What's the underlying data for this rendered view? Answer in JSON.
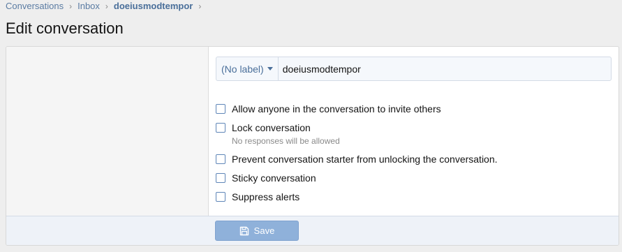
{
  "breadcrumb": {
    "items": [
      "Conversations",
      "Inbox",
      "doeiusmodtempor"
    ],
    "separator": "›"
  },
  "page_title": "Edit conversation",
  "form": {
    "prefix_label": "(No label)",
    "title_value": "doeiusmodtempor",
    "options": [
      {
        "label": "Allow anyone in the conversation to invite others",
        "checked": false
      },
      {
        "label": "Lock conversation",
        "hint": "No responses will be allowed",
        "checked": false
      },
      {
        "label": "Prevent conversation starter from unlocking the conversation.",
        "checked": false
      },
      {
        "label": "Sticky conversation",
        "checked": false
      },
      {
        "label": "Suppress alerts",
        "checked": false
      }
    ]
  },
  "footer": {
    "save_label": "Save",
    "save_icon": "save-icon"
  },
  "colors": {
    "link": "#5b7ca3",
    "accent": "#4a6f9a",
    "button_bg": "#8fb1da",
    "footer_bg": "#eef2f8"
  }
}
